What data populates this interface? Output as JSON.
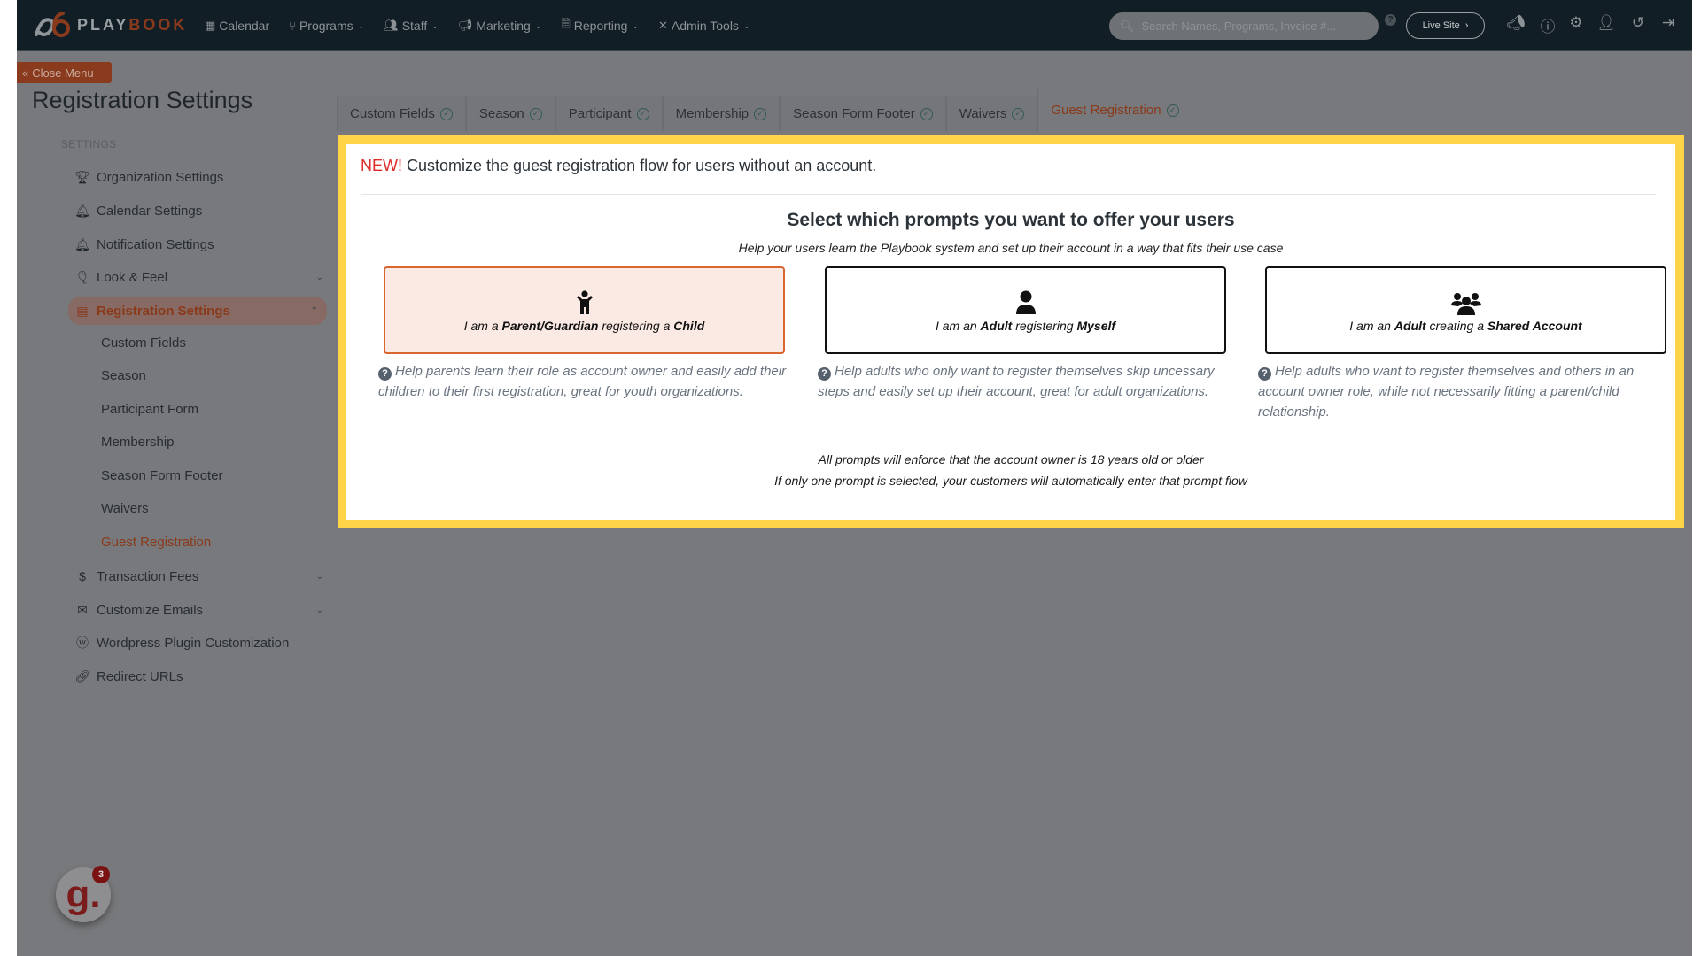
{
  "topnav": {
    "logo_text_a": "PLAY",
    "logo_text_b": "BOOK",
    "items": [
      {
        "label": "Calendar",
        "icon": "calendar-icon",
        "dropdown": false
      },
      {
        "label": "Programs",
        "icon": "branch-icon",
        "dropdown": true
      },
      {
        "label": "Staff",
        "icon": "users-icon",
        "dropdown": true
      },
      {
        "label": "Marketing",
        "icon": "megaphone-icon",
        "dropdown": true
      },
      {
        "label": "Reporting",
        "icon": "document-icon",
        "dropdown": true
      },
      {
        "label": "Admin Tools",
        "icon": "tools-icon",
        "dropdown": true
      }
    ],
    "search_placeholder": "Search Names, Programs, Invoice #...",
    "live_site_label": "Live Site",
    "right_icons": [
      "announcement-icon",
      "help-icon",
      "gear-icon",
      "add-user-icon",
      "history-icon",
      "logout-icon"
    ]
  },
  "sidebar": {
    "close_menu_label": "Close Menu",
    "page_title": "Registration Settings",
    "section_label": "SETTINGS",
    "items": [
      {
        "label": "Organization Settings",
        "icon": "trophy-icon"
      },
      {
        "label": "Calendar Settings",
        "icon": "bell-icon"
      },
      {
        "label": "Notification Settings",
        "icon": "bell-icon"
      },
      {
        "label": "Look & Feel",
        "icon": "balloon-icon",
        "expandable": true
      },
      {
        "label": "Registration Settings",
        "icon": "form-icon",
        "expandable": true,
        "expanded": true,
        "active": true
      },
      {
        "label": "Transaction Fees",
        "icon": "dollar-icon",
        "expandable": true
      },
      {
        "label": "Customize Emails",
        "icon": "envelope-icon",
        "expandable": true
      },
      {
        "label": "Wordpress Plugin Customization",
        "icon": "wordpress-icon"
      },
      {
        "label": "Redirect URLs",
        "icon": "link-icon"
      }
    ],
    "sub_items": [
      "Custom Fields",
      "Season",
      "Participant Form",
      "Membership",
      "Season Form Footer",
      "Waivers",
      "Guest Registration"
    ],
    "current_sub_item": "Guest Registration"
  },
  "tabs": [
    {
      "label": "Custom Fields",
      "complete": true
    },
    {
      "label": "Season",
      "complete": true
    },
    {
      "label": "Participant",
      "complete": true
    },
    {
      "label": "Membership",
      "complete": true
    },
    {
      "label": "Season Form Footer",
      "complete": true
    },
    {
      "label": "Waivers",
      "complete": true
    },
    {
      "label": "Guest Registration",
      "complete": true,
      "active": true
    }
  ],
  "panel": {
    "new_badge": "NEW!",
    "intro": " Customize the guest registration flow for users without an account.",
    "prompt_title": "Select which prompts you want to offer your users",
    "prompt_subtitle": "Help your users learn the Playbook system and set up their account in a way that fits their use case",
    "cards": [
      {
        "icon": "child-icon",
        "label_parts": [
          "I am a ",
          "Parent/Guardian",
          " registering a ",
          "Child"
        ],
        "selected": true,
        "description": "Help parents learn their role as account owner and easily add their children to their first registration, great for youth organizations."
      },
      {
        "icon": "user-icon",
        "label_parts": [
          "I am an ",
          "Adult",
          " registering ",
          "Myself"
        ],
        "selected": false,
        "description": "Help adults who only want to register themselves skip uncessary steps and easily set up their account, great for adult organizations."
      },
      {
        "icon": "users-group-icon",
        "label_parts": [
          "I am an ",
          "Adult",
          " creating a ",
          "Shared Account"
        ],
        "selected": false,
        "description": "Help adults who want to register themselves and others in an account owner role, while not necessarily fitting a parent/child relationship."
      }
    ],
    "footnotes": [
      "All prompts will enforce that the account owner is 18 years old or older",
      "If only one prompt is selected, your customers will automatically enter that prompt flow"
    ]
  },
  "widget": {
    "glyph": "g.",
    "badge_count": "3"
  },
  "colors": {
    "brand_orange": "#d9652f",
    "highlight_yellow": "#ffd447",
    "new_red": "#e02a2a",
    "nav_bg": "#121e26"
  }
}
